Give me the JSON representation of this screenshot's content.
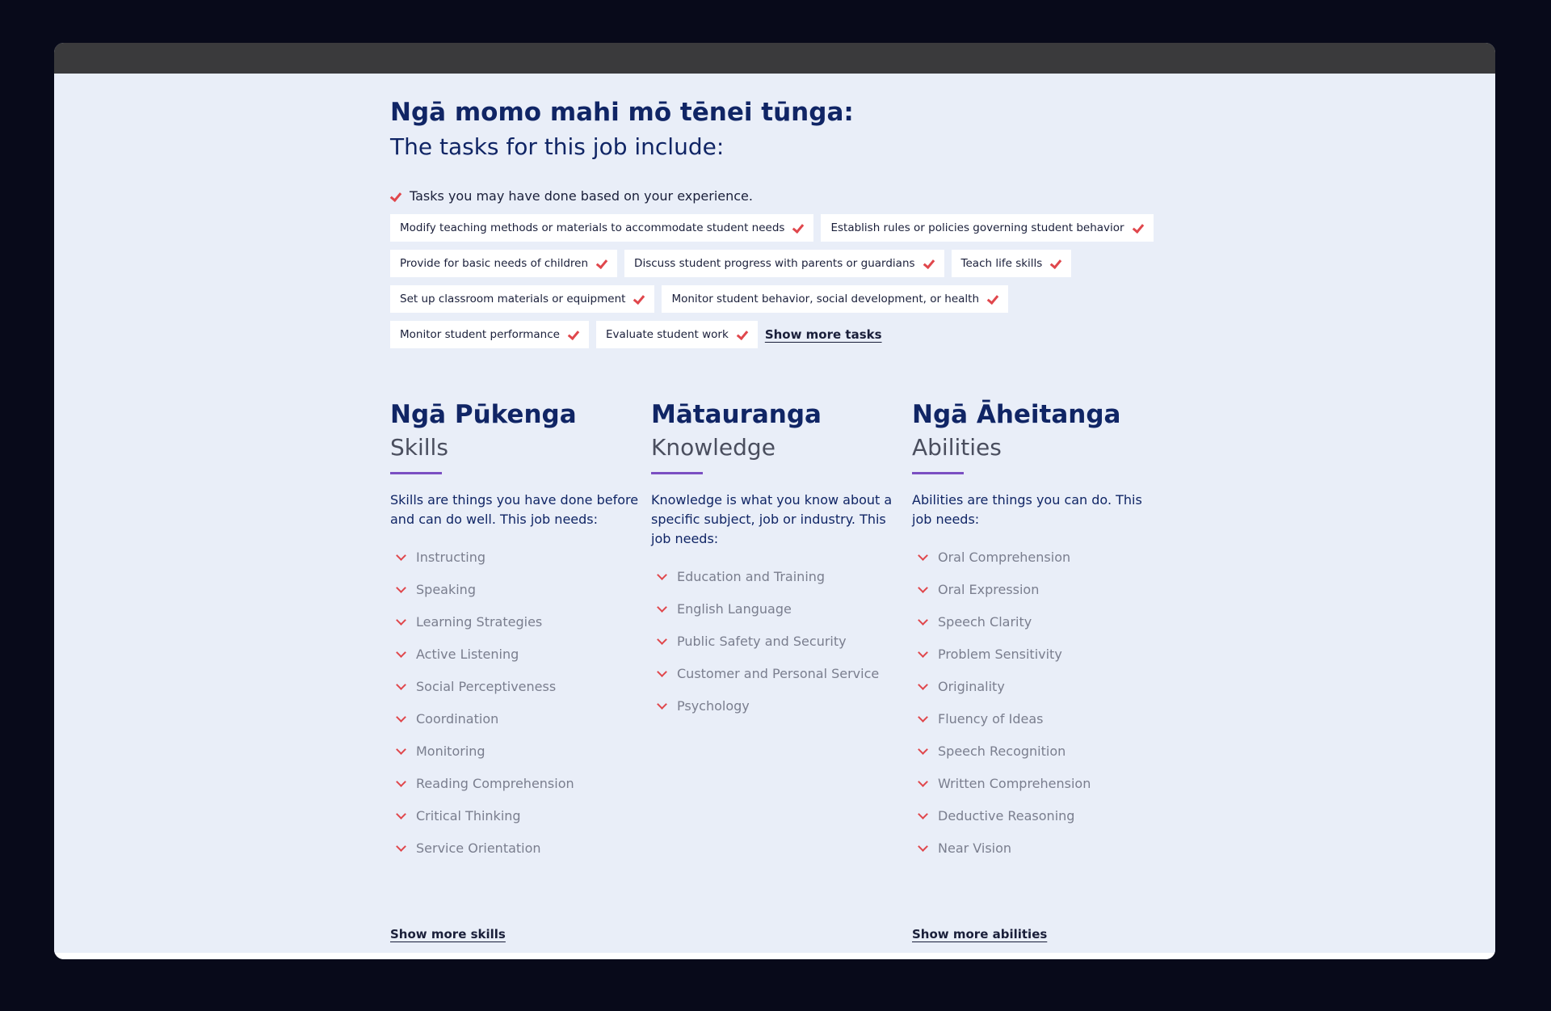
{
  "heading": {
    "title_mi": "Ngā momo mahi mō tēnei tūnga:",
    "title_en": "The tasks for this job include:"
  },
  "legend": {
    "text": "Tasks you may have done based on your experience."
  },
  "tasks": [
    [
      "Modify teaching methods or materials to accommodate student needs",
      "Establish rules or policies governing student behavior"
    ],
    [
      "Provide for basic needs of children",
      "Discuss student progress with parents or guardians",
      "Teach life skills"
    ],
    [
      "Set up classroom materials or equipment",
      "Monitor student behavior, social development, or health"
    ],
    [
      "Monitor student performance",
      "Evaluate student work"
    ]
  ],
  "show_more_tasks": "Show more tasks",
  "skills": {
    "title_mi": "Ngā Pūkenga",
    "title_en": "Skills",
    "description": "Skills are things you have done before and can do well. This job needs:",
    "items": [
      "Instructing",
      "Speaking",
      "Learning Strategies",
      "Active Listening",
      "Social Perceptiveness",
      "Coordination",
      "Monitoring",
      "Reading Comprehension",
      "Critical Thinking",
      "Service Orientation"
    ],
    "show_more": "Show more skills"
  },
  "knowledge": {
    "title_mi": "Mātauranga",
    "title_en": "Knowledge",
    "description": "Knowledge is what you know about a specific subject, job or industry. This job needs:",
    "items": [
      "Education and Training",
      "English Language",
      "Public Safety and Security",
      "Customer and Personal Service",
      "Psychology"
    ]
  },
  "abilities": {
    "title_mi": "Ngā Āheitanga",
    "title_en": "Abilities",
    "description": "Abilities are things you can do. This job needs:",
    "items": [
      "Oral Comprehension",
      "Oral Expression",
      "Speech Clarity",
      "Problem Sensitivity",
      "Originality",
      "Fluency of Ideas",
      "Speech Recognition",
      "Written Comprehension",
      "Deductive Reasoning",
      "Near Vision"
    ],
    "show_more": "Show more abilities"
  },
  "colors": {
    "heading": "#102565",
    "accent_check": "#e0474c",
    "rule": "#7b4fc2",
    "background": "#e9eef8"
  }
}
